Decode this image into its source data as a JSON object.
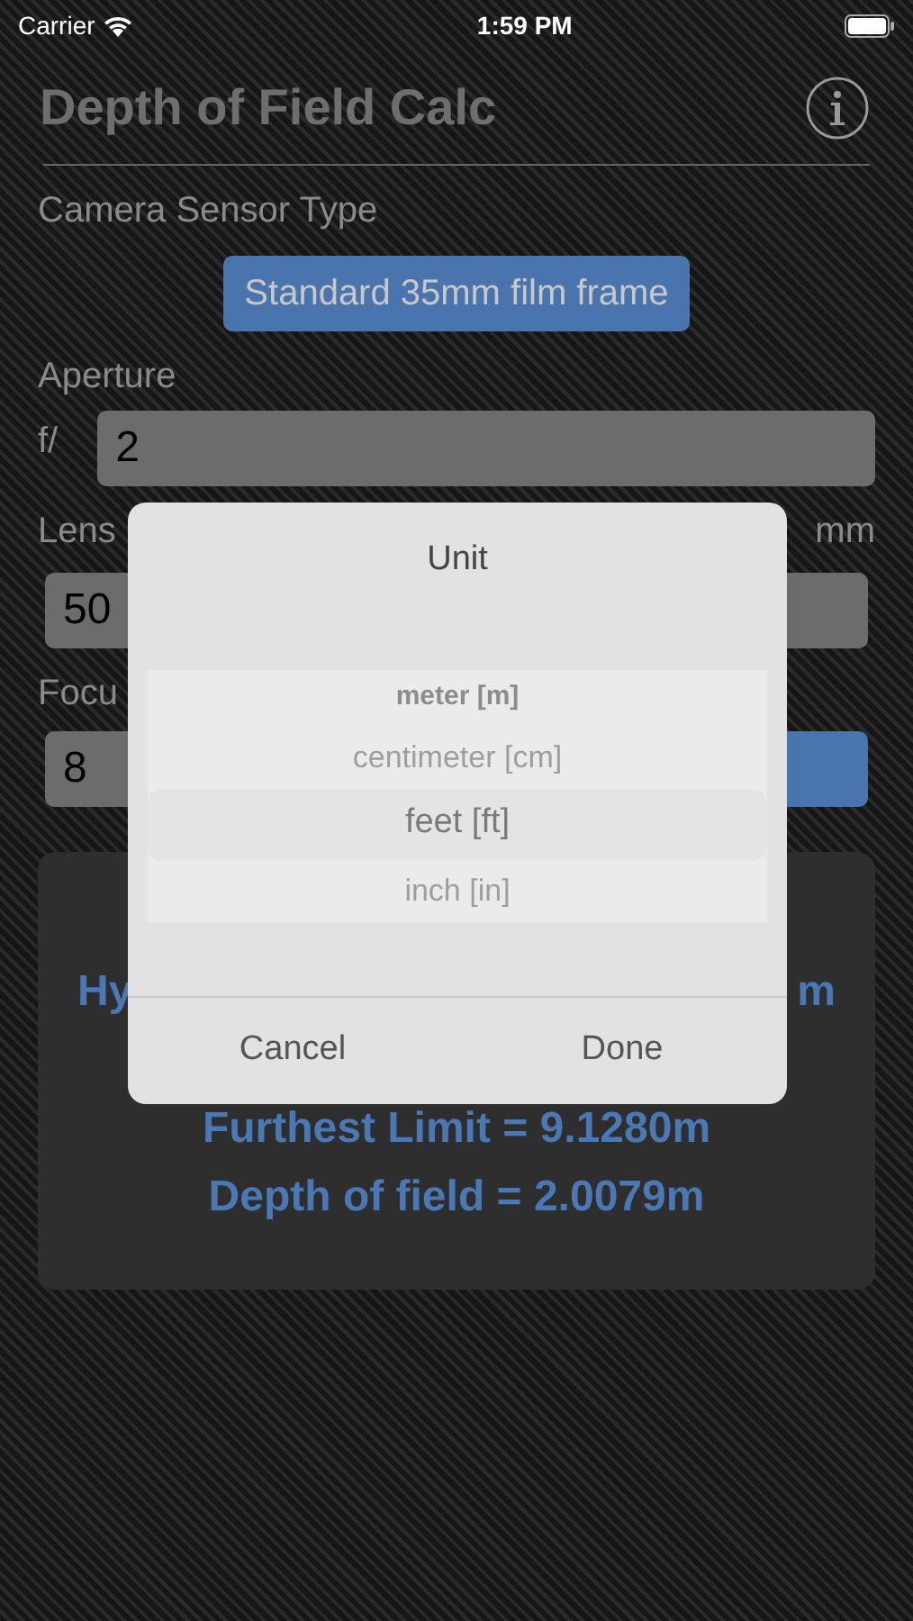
{
  "status_bar": {
    "carrier": "Carrier",
    "time": "1:59 PM"
  },
  "title": "Depth of Field Calc",
  "sensor": {
    "label": "Camera Sensor Type",
    "button": "Standard 35mm film frame"
  },
  "aperture": {
    "label": "Aperture",
    "prefix": "f/",
    "value": "2"
  },
  "lens": {
    "label": "Lens",
    "unit": "mm",
    "value": "50"
  },
  "focus": {
    "label": "Focu",
    "value": "8"
  },
  "results": {
    "hyperfocal_left": "Hy",
    "hyperfocal_right": "m",
    "furthest": "Furthest Limit = 9.1280m",
    "depth": "Depth of field = 2.0079m"
  },
  "dialog": {
    "title": "Unit",
    "options": [
      {
        "label": "meter [m]",
        "selected": false
      },
      {
        "label": "centimeter [cm]",
        "selected": false
      },
      {
        "label": "feet [ft]",
        "selected": true
      },
      {
        "label": "inch [in]",
        "selected": false
      }
    ],
    "buttons": [
      "Cancel",
      "Done"
    ]
  }
}
